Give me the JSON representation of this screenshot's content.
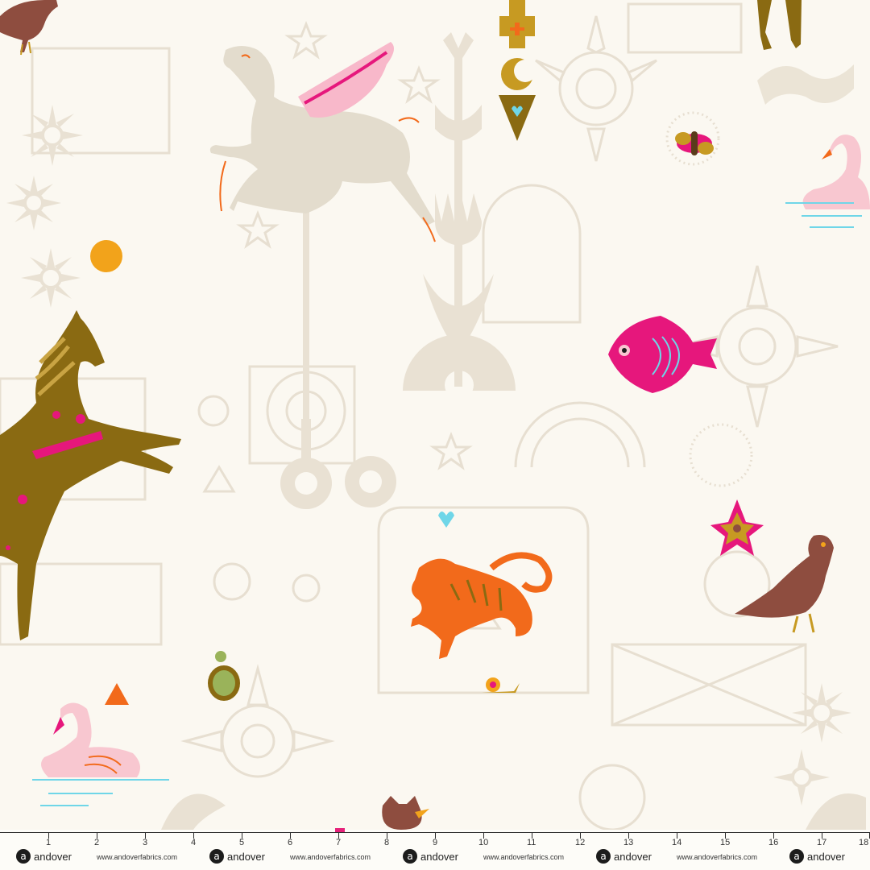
{
  "selvage": {
    "brand_name": "andover",
    "url": "www.andoverfabrics.com",
    "logo_glyph": "a",
    "ruler_numbers": [
      "1",
      "2",
      "3",
      "4",
      "5",
      "6",
      "7",
      "8",
      "9",
      "10",
      "11",
      "12",
      "13",
      "14",
      "15",
      "16",
      "17",
      "18"
    ]
  },
  "colors": {
    "background": "#fbf8f1",
    "line_art": "#e7dfd1",
    "olive_horse": "#8a6a12",
    "pink": "#e6177c",
    "orange": "#f26a1b",
    "gold": "#f2a31b",
    "brown_bird": "#8e4d3f",
    "swan_pink": "#f8c7d0",
    "water": "#6fd6e8"
  }
}
